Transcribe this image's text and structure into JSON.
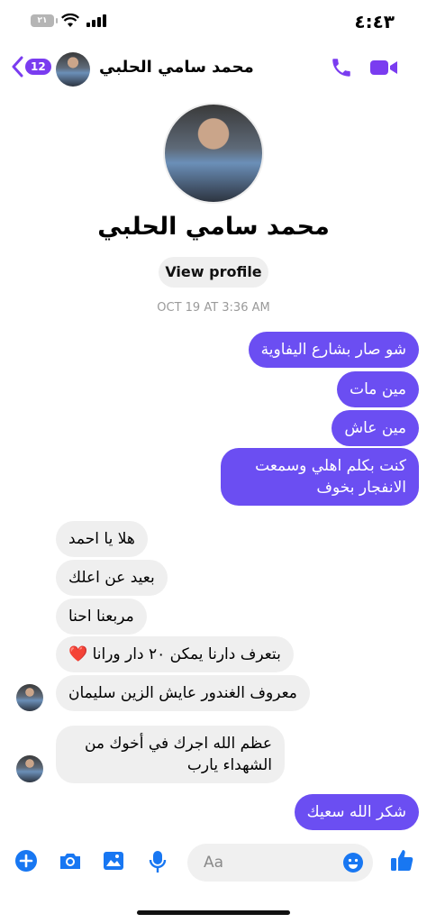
{
  "status": {
    "time": "٤:٤٣",
    "battery": "٢١"
  },
  "header": {
    "back_count": "12",
    "name": "محمد سامي الحلبي"
  },
  "profile": {
    "name": "محمد سامي الحلبي",
    "view_profile": "View profile"
  },
  "timestamp": "OCT 19 AT 3:36 AM",
  "messages_out": [
    "شو صار بشارع اليفاوية",
    "مين مات",
    "مين عاش",
    "كنت بكلم اهلي وسمعت الانفجار بخوف",
    "شكر الله سعيك"
  ],
  "messages_in": [
    "هلا يا احمد",
    "بعيد عن اعلك",
    "مربعنا احنا",
    "بتعرف دارنا يمكن ٢٠ دار ورانا",
    "معروف الغندور عايش الزين سليمان",
    "عظم الله اجرك في أخوك من الشهداء يارب"
  ],
  "heart": "❤️",
  "composer": {
    "placeholder": "Aa"
  },
  "colors": {
    "accent": "#7a3cf0",
    "bubble_out": "#6b4ef2",
    "bubble_in": "#efefef",
    "composer_blue": "#1877f2"
  }
}
